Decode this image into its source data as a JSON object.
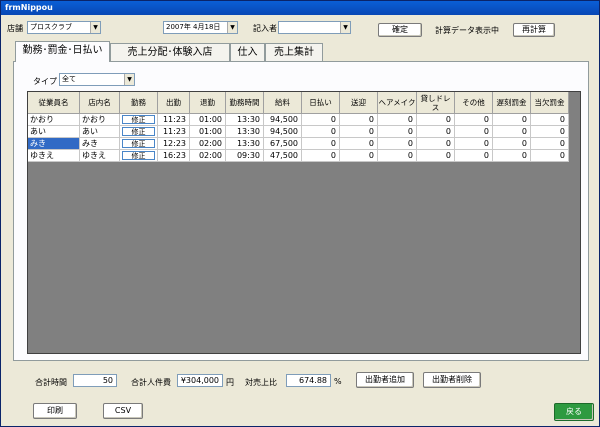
{
  "window": {
    "title": "frmNippou"
  },
  "header": {
    "store_label": "店舗",
    "store_value": "プロスクラブ",
    "date_value": "2007年 4月18日",
    "recorder_label": "記入者",
    "recorder_value": "",
    "confirm_label": "確定",
    "status_text": "計算データ表示中",
    "recalc_label": "再計算"
  },
  "tabs": [
    {
      "label": "勤務･罰金･日払い"
    },
    {
      "label": "売上分配･体験入店"
    },
    {
      "label": "仕入"
    },
    {
      "label": "売上集計"
    }
  ],
  "filter": {
    "type_label": "タイプ",
    "type_value": "全て"
  },
  "table": {
    "columns": [
      {
        "label": "従業員名"
      },
      {
        "label": "店内名"
      },
      {
        "label": "勤務"
      },
      {
        "label": "出勤"
      },
      {
        "label": "退勤"
      },
      {
        "label": "勤務時間"
      },
      {
        "label": "給料"
      },
      {
        "label": "日払い"
      },
      {
        "label": "送迎"
      },
      {
        "label": "ヘアメイク"
      },
      {
        "label": "貸しドレス"
      },
      {
        "label": "その他"
      },
      {
        "label": "遅刻罰金"
      },
      {
        "label": "当欠罰金"
      }
    ],
    "rows": [
      {
        "name": "かおり",
        "store_name": "かおり",
        "shift": "修正",
        "in": "11:23",
        "out": "01:00",
        "hours": "13:30",
        "pay": "94,500",
        "advance": "0",
        "pickup": "0",
        "hair": "0",
        "dress": "0",
        "other": "0",
        "late_fine": "0",
        "absent_fine": "0"
      },
      {
        "name": "あい",
        "store_name": "あい",
        "shift": "修正",
        "in": "11:23",
        "out": "01:00",
        "hours": "13:30",
        "pay": "94,500",
        "advance": "0",
        "pickup": "0",
        "hair": "0",
        "dress": "0",
        "other": "0",
        "late_fine": "0",
        "absent_fine": "0"
      },
      {
        "name": "みき",
        "store_name": "みき",
        "shift": "修正",
        "in": "12:23",
        "out": "02:00",
        "hours": "13:30",
        "pay": "67,500",
        "advance": "0",
        "pickup": "0",
        "hair": "0",
        "dress": "0",
        "other": "0",
        "late_fine": "0",
        "absent_fine": "0"
      },
      {
        "name": "ゆきえ",
        "store_name": "ゆきえ",
        "shift": "修正",
        "in": "16:23",
        "out": "02:00",
        "hours": "09:30",
        "pay": "47,500",
        "advance": "0",
        "pickup": "0",
        "hair": "0",
        "dress": "0",
        "other": "0",
        "late_fine": "0",
        "absent_fine": "0"
      }
    ]
  },
  "summary": {
    "total_time_label": "合計時間",
    "total_time_value": "50",
    "total_cost_label": "合計人件費",
    "total_cost_value": "¥304,000",
    "yen_unit": "円",
    "ratio_label": "対売上比",
    "ratio_value": "674.88",
    "percent_unit": "%",
    "add_worker_label": "出勤者追加",
    "remove_worker_label": "出勤者削除"
  },
  "footer": {
    "print_label": "印刷",
    "csv_label": "CSV",
    "back_label": "戻る"
  }
}
